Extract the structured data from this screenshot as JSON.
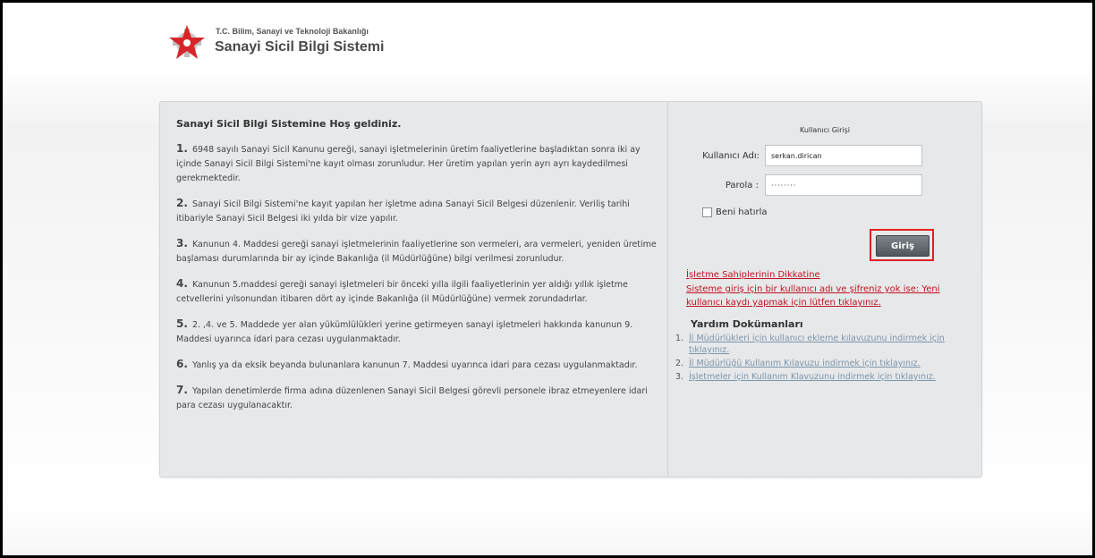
{
  "header": {
    "ministry": "T.C. Bilim, Sanayi ve Teknoloji Bakanlığı",
    "system": "Sanayi Sicil Bilgi Sistemi",
    "logo_icon": "gear-star-logo-icon"
  },
  "info": {
    "welcome": "Sanayi Sicil Bilgi Sistemine Hoş geldiniz.",
    "paragraphs": [
      {
        "num": "1.",
        "text": "6948 sayılı Sanayi Sicil Kanunu gereği, sanayi işletmelerinin üretim faaliyetlerine başladıktan sonra iki ay içinde Sanayi Sicil Bilgi Sistemi'ne kayıt olması zorunludur. Her üretim yapılan yerin ayrı ayrı kaydedilmesi gerekmektedir."
      },
      {
        "num": "2.",
        "text": "Sanayi Sicil Bilgi Sistemi'ne kayıt yapılan her işletme adına Sanayi Sicil Belgesi düzenlenir. Veriliş tarihi itibariyle Sanayi Sicil Belgesi iki yılda bir vize yapılır."
      },
      {
        "num": "3.",
        "text": "Kanunun 4. Maddesi gereği sanayi işletmelerinin faaliyetlerine son vermeleri, ara vermeleri, yeniden üretime başlaması durumlarında bir ay içinde Bakanlığa (il Müdürlüğüne) bilgi verilmesi zorunludur."
      },
      {
        "num": "4.",
        "text": "Kanunun 5.maddesi gereği sanayi işletmeleri bir önceki yılla ilgili faaliyetlerinin yer aldığı yıllık işletme cetvellerini yılsonundan itibaren dört ay içinde Bakanlığa (il Müdürlüğüne) vermek zorundadırlar."
      },
      {
        "num": "5.",
        "text": "2. ,4. ve 5. Maddede yer alan yükümlülükleri yerine getirmeyen sanayi işletmeleri hakkında kanunun 9. Maddesi uyarınca idari para cezası uygulanmaktadır."
      },
      {
        "num": "6.",
        "text": "Yanlış ya da eksik beyanda bulunanlara kanunun 7. Maddesi uyarınca idari para cezası uygulanmaktadır."
      },
      {
        "num": "7.",
        "text": "Yapılan denetimlerde firma adına düzenlenen Sanayi Sicil Belgesi görevli personele ibraz etmeyenlere idari para cezası uygulanacaktır."
      }
    ]
  },
  "login": {
    "title": "Kullanıcı Girişi",
    "username_label": "Kullanıcı Adı:",
    "username_value": "serkan.dirican",
    "password_label": "Parola :",
    "password_value": "········",
    "remember_label": "Beni hatırla",
    "submit_label": "Giriş"
  },
  "alerts": {
    "owners_link": "İşletme Sahiplerinin Dikkatine",
    "register_link": "Sisteme giriş için bir kullanıcı adı ve şifreniz yok ise: Yeni kullanıcı kaydı yapmak için lütfen tıklayınız."
  },
  "help": {
    "title": "Yardım Dokümanları",
    "items": [
      {
        "num": "1.",
        "text": "İl Müdürlükleri için kullanıcı ekleme kılavuzunu indirmek için tıklayınız."
      },
      {
        "num": "2.",
        "text": "İl Müdürlüğü Kullanım Kılavuzu indirmek için tıklayınız."
      },
      {
        "num": "3.",
        "text": "İşletmeler için Kullanım Klavuzunu indirmek için tıklayınız."
      }
    ]
  },
  "colors": {
    "alert_red": "#c0131e",
    "link_blue": "#7d95a8",
    "panel_bg": "#e6e8ea",
    "highlight_box": "#e02020"
  }
}
